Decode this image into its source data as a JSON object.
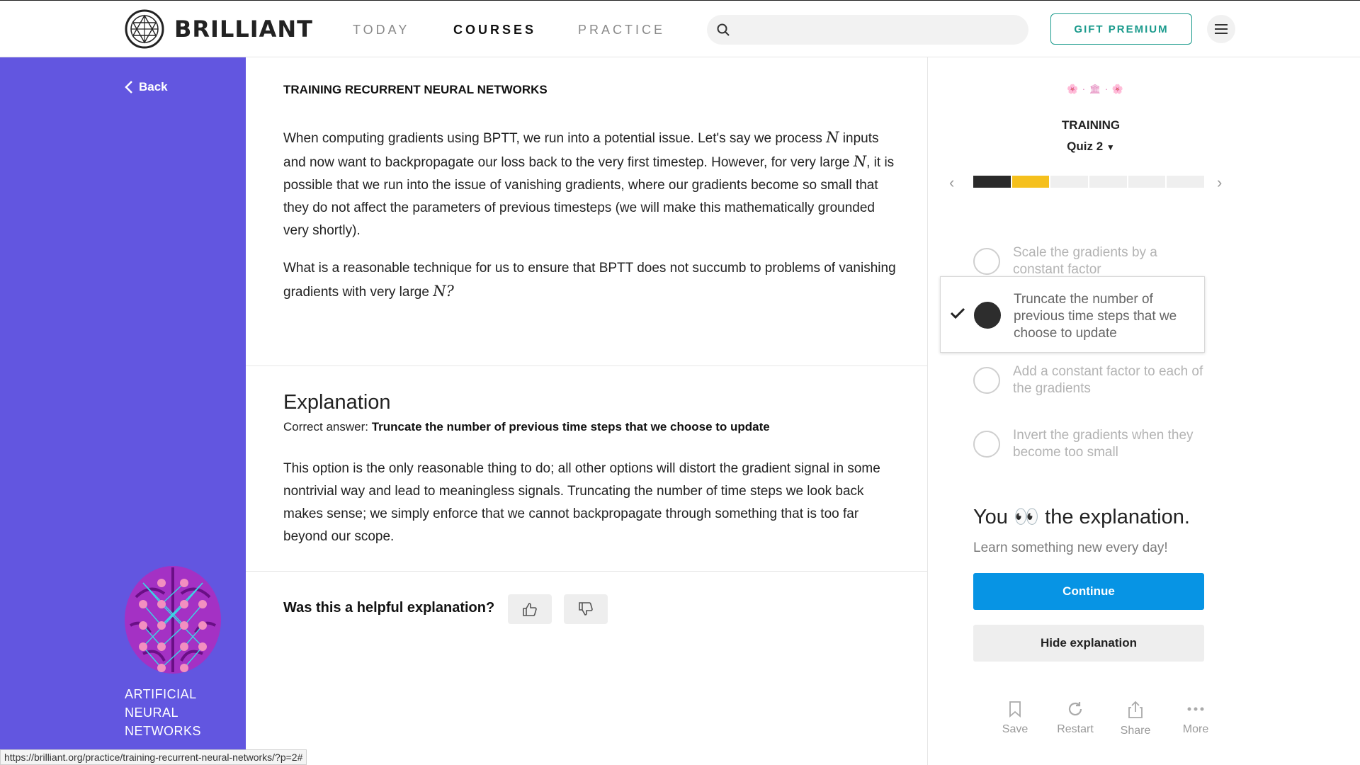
{
  "header": {
    "logo_text": "BRILLIANT",
    "nav": [
      {
        "label": "TODAY",
        "active": false
      },
      {
        "label": "COURSES",
        "active": true
      },
      {
        "label": "PRACTICE",
        "active": false
      }
    ],
    "search_placeholder": "",
    "gift_label": "GIFT PREMIUM"
  },
  "sidebar": {
    "back_label": "Back",
    "course_title": "ARTIFICIAL NEURAL NETWORKS"
  },
  "lesson": {
    "title": "TRAINING RECURRENT NEURAL NETWORKS",
    "p1_a": "When computing gradients using BPTT, we run into a potential issue. Let's say we process ",
    "var_n": "N",
    "p1_b": " inputs and now want to backpropagate our loss back to the very first timestep. However, for very large ",
    "p1_c": ", it is possible that we run into the issue of vanishing gradients, where our gradients become so small that they do not affect the parameters of previous timesteps (we will make this mathematically grounded very shortly).",
    "p2_a": "What is a reasonable technique for us to ensure that BPTT does not succumb to problems of vanishing gradients with very large ",
    "p2_b": "?"
  },
  "explanation": {
    "heading": "Explanation",
    "correct_prefix": "Correct answer: ",
    "correct_answer": "Truncate the number of previous time steps that we choose to update",
    "body": "This option is the only reasonable thing to do; all other options will distort the gradient signal in some nontrivial way and lead to meaningless signals. Truncating the number of time steps we look back makes sense; we simply enforce that we cannot backpropagate through something that is too far beyond our scope.",
    "helpful_question": "Was this a helpful explanation?"
  },
  "quiz": {
    "badge": "🌸 · 🏛 · 🌸",
    "section": "TRAINING",
    "selector": "Quiz 2",
    "progress": {
      "total": 6,
      "done": 1,
      "current": 2
    },
    "options": [
      {
        "text": "Scale the gradients by a constant factor",
        "selected": false
      },
      {
        "text": "Truncate the number of previous time steps that we choose to update",
        "selected": true
      },
      {
        "text": "Add a constant factor to each of the gradients",
        "selected": false
      },
      {
        "text": "Invert the gradients when they become too small",
        "selected": false
      }
    ],
    "you_text": "You 👀 the explanation.",
    "learn_text": "Learn something new every day!",
    "continue_label": "Continue",
    "hide_label": "Hide explanation",
    "actions": [
      {
        "label": "Save",
        "icon": "bookmark-icon"
      },
      {
        "label": "Restart",
        "icon": "restart-icon"
      },
      {
        "label": "Share",
        "icon": "share-icon"
      },
      {
        "label": "More",
        "icon": "more-icon"
      }
    ]
  },
  "status_url": "https://brilliant.org/practice/training-recurrent-neural-networks/?p=2#",
  "colors": {
    "sidebar": "#6256e0",
    "accent_teal": "#1a9a8c",
    "continue_blue": "#0794e4",
    "progress_current": "#f5c01d"
  }
}
